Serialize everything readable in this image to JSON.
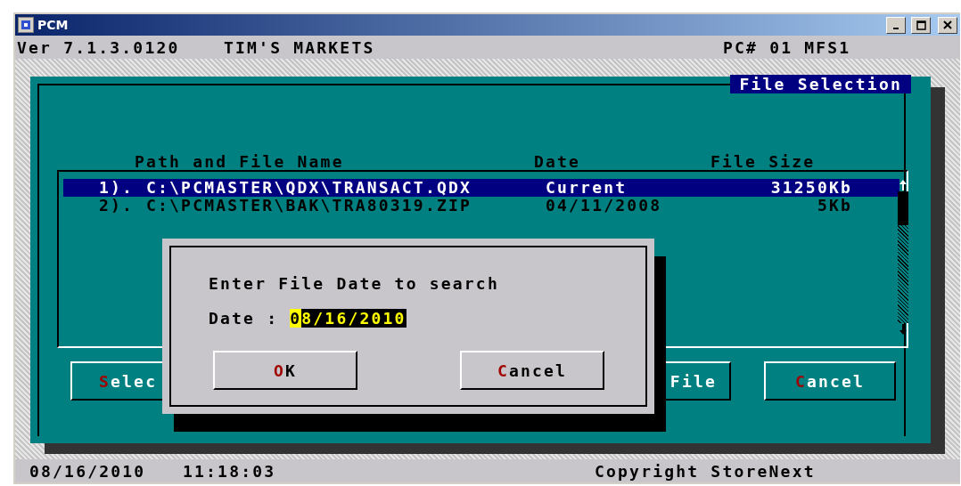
{
  "window": {
    "title": "PCM"
  },
  "header": {
    "version": "Ver 7.1.3.0120",
    "store": "TIM'S MARKETS",
    "station": "PC# 01 MFS1"
  },
  "panel": {
    "title": "File Selection",
    "columns": [
      "Path and File Name",
      "Date",
      "File Size"
    ],
    "rows": [
      {
        "number": "1).",
        "path": "C:\\PCMASTER\\QDX\\TRANSACT.QDX",
        "date": "Current",
        "size": "31250Kb",
        "selected": true
      },
      {
        "number": "2).",
        "path": "C:\\PCMASTER\\BAK\\TRA80319.ZIP",
        "date": "04/11/2008",
        "size": "5Kb",
        "selected": false
      }
    ],
    "buttons": [
      {
        "label": "Selec",
        "hotkey": true
      },
      {
        "label": "File",
        "hotkey": false
      },
      {
        "label": "Cancel",
        "hotkey": true
      }
    ]
  },
  "dialog": {
    "prompt": "Enter File Date to search",
    "field_label": "Date :",
    "value": "08/16/2010",
    "buttons": [
      {
        "label": "OK",
        "hotkey": true
      },
      {
        "label": "Cancel",
        "hotkey": true
      }
    ]
  },
  "status_bar": {
    "date": "08/16/2010",
    "time": "11:18:03",
    "copyright": "Copyright StoreNext"
  }
}
